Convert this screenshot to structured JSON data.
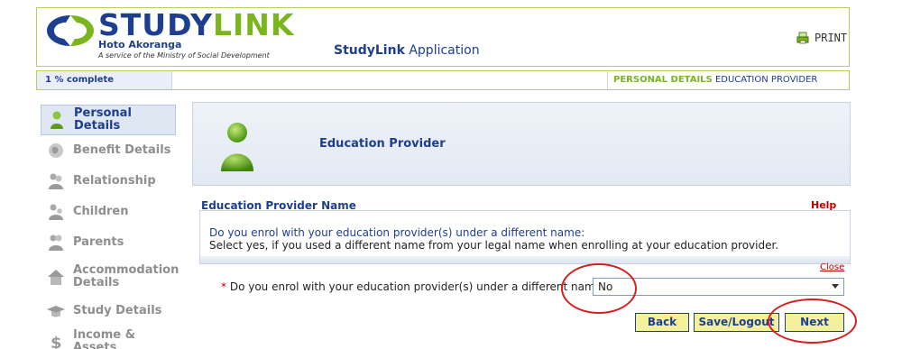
{
  "header": {
    "logo_word_1": "STUDY",
    "logo_word_2": "LINK",
    "logo_subtitle": "Hoto Akoranga",
    "logo_tagline": "A service of the Ministry of Social Development",
    "app_title_bold": "StudyLink",
    "app_title_rest": " Application",
    "print_label": "PRINT"
  },
  "progress": {
    "text": "1 % complete",
    "value_percent": 1,
    "crumbs": [
      {
        "label": "PERSONAL DETAILS",
        "active": true
      },
      {
        "label": "EDUCATION PROVIDER",
        "active": false
      }
    ]
  },
  "sidebar": {
    "items": [
      {
        "label": "Personal Details",
        "icon": "person-icon",
        "active": true
      },
      {
        "label": "Benefit Details",
        "icon": "benefit-icon",
        "active": false
      },
      {
        "label": "Relationship",
        "icon": "relationship-icon",
        "active": false
      },
      {
        "label": "Children",
        "icon": "children-icon",
        "active": false
      },
      {
        "label": "Parents",
        "icon": "parents-icon",
        "active": false
      },
      {
        "label": "Accommodation Details",
        "icon": "house-icon",
        "active": false
      },
      {
        "label": "Study Details",
        "icon": "graduation-cap-icon",
        "active": false
      },
      {
        "label": "Income & Assets",
        "icon": "dollar-icon",
        "active": false
      }
    ]
  },
  "main": {
    "panel_title": "Education Provider",
    "section_title": "Education Provider Name",
    "help_label": "Help",
    "help_question": "Do you enrol with your education provider(s) under a different name:",
    "help_description": "Select yes, if you used a different name from your legal name when enrolling at your education provider.",
    "close_label": "Close",
    "required_marker": "*",
    "question_label": "Do you enrol with your education provider(s) under a different name:",
    "select_value": "No"
  },
  "buttons": {
    "back": "Back",
    "save": "Save/Logout",
    "next": "Next"
  },
  "colors": {
    "brand_blue": "#1e3f8f",
    "brand_green": "#7ab51d",
    "button_fill": "#f5f09a",
    "annotation_red": "#d91e1e"
  }
}
